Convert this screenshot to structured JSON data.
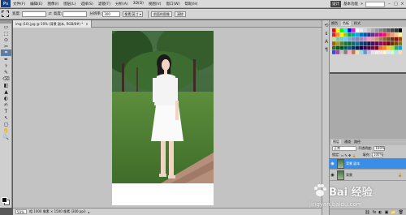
{
  "app": {
    "logo": "Ps"
  },
  "menu": [
    "文件(F)",
    "编辑(E)",
    "图像(I)",
    "图层(L)",
    "选择(S)",
    "滤镜(T)",
    "分析(A)",
    "3D(D)",
    "视图(V)",
    "窗口(W)",
    "帮助(H)"
  ],
  "workspace": {
    "badge": "设计",
    "label": "基本功能",
    "arrow": "»"
  },
  "window_buttons": [
    "–",
    "□",
    "×"
  ],
  "options": {
    "width_label": "宽度:",
    "height_label": "高度:",
    "resolution_label": "分辨率:",
    "resolution_value": "300",
    "unit_select": "像素/英寸 ▾",
    "front_image_btn": "前面的图像",
    "clear_btn": "清除"
  },
  "tools": [
    "▭",
    "⬚",
    "⊙",
    "✂",
    "⌗",
    "✒",
    "⚕",
    "✎",
    "⌫",
    "◧",
    "▲",
    "◐",
    "✍",
    "T",
    "↖",
    "▢",
    "✋",
    "🔍"
  ],
  "document": {
    "tab_title": "img (10).jpg @ 50% (背景 副本, RGB/8#) *",
    "tab_close": "×",
    "zoom": "50%",
    "status": "相 1000 像素 × 1500 像素 (300 ppi)",
    "status_arrow": "▸"
  },
  "swatches": {
    "tabs": [
      "颜色",
      "色板",
      "样式"
    ],
    "active_tab": 1,
    "colors": [
      "#ff0000",
      "#ffff00",
      "#00ff00",
      "#00ffff",
      "#0000ff",
      "#ff00ff",
      "#ffffff",
      "#ebebeb",
      "#d6d6d6",
      "#c2c2c2",
      "#adadad",
      "#999999",
      "#858585",
      "#707070",
      "#5c5c5c",
      "#474747",
      "#333333",
      "#000000",
      "#ed1c24",
      "#f7941d",
      "#fff200",
      "#8dc63f",
      "#00a651",
      "#00a99d",
      "#00aeef",
      "#0072bc",
      "#0054a6",
      "#2e3192",
      "#662d91",
      "#92278f",
      "#ec008c",
      "#ed145b",
      "#f26c4f",
      "#f69679",
      "#fdc689",
      "#fff799",
      "#c4df9b",
      "#82ca9c",
      "#7accc8",
      "#6dcff6",
      "#7da7d9",
      "#8393ca",
      "#8781bd",
      "#a187be",
      "#bd8cbf",
      "#f49ac2",
      "#f6989d",
      "#c69c6d",
      "#a67c52",
      "#8c6239",
      "#754c24",
      "#603913",
      "#9e0b0f",
      "#a0410d",
      "#a3620a",
      "#aba000",
      "#598527",
      "#197b30",
      "#007236",
      "#00746b",
      "#0076a3",
      "#004a80",
      "#003471",
      "#1b1464",
      "#440e62",
      "#630460",
      "#9e005d",
      "#9e0039",
      "#790000",
      "#7b2e00",
      "#7d4900",
      "#827b00",
      "#406618",
      "#005e20",
      "#005826",
      "#005952",
      "#005b7f",
      "#003663",
      "#002157",
      "#0d004c",
      "#32004b",
      "#4b0049",
      "#7b0046",
      "#7a0026",
      "#f26522",
      "#ff7f27",
      "#ffc90e",
      "#b5e61d",
      "#22b14c",
      "#00a2e8",
      "#3f48cc",
      "#a349a4",
      "#c3c3c3",
      "#7f7f7f",
      "#ffaec9",
      "#b97a57",
      "#efe4b0",
      "#99d9ea",
      "#7092be",
      "#c8bfe7",
      "#e5e5e5",
      "#f0f0f0",
      "#ffe4e1",
      "#fafad2",
      "#e6e6fa",
      "#d3ffce",
      "#b0e0e6",
      "#ffdab9"
    ]
  },
  "layers": {
    "tabs": [
      "图层",
      "通道",
      "路径"
    ],
    "active_tab": 0,
    "blend_mode": "正常",
    "opacity_label": "不透明度:",
    "opacity": "100%",
    "lock_label": "锁定:",
    "fill_label": "填充:",
    "fill": "100%",
    "items": [
      {
        "name": "背景 副本",
        "selected": true,
        "lock": ""
      },
      {
        "name": "背景",
        "selected": false,
        "lock": "🔒"
      }
    ],
    "footer_icons": [
      "⛓",
      "fx",
      "◐",
      "▣",
      "📁",
      "🗑"
    ]
  },
  "watermark": {
    "main": "Bai 经验",
    "url": "jingyan.baidu.com"
  }
}
